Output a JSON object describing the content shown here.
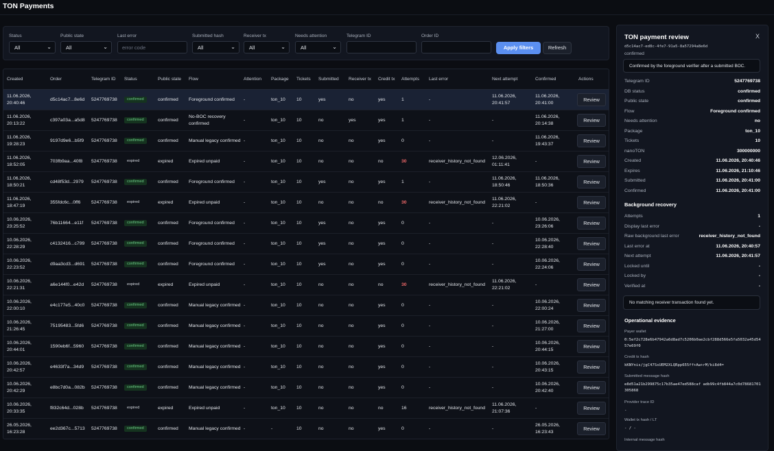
{
  "app": {
    "title": "TON Payments"
  },
  "filters": {
    "status": {
      "label": "Status",
      "value": "All"
    },
    "public_state": {
      "label": "Public state",
      "value": "All"
    },
    "last_error": {
      "label": "Last error",
      "placeholder": "error code"
    },
    "submitted_hash": {
      "label": "Submitted hash",
      "value": "All"
    },
    "receiver_tx": {
      "label": "Receiver tx",
      "value": "All"
    },
    "needs_attention": {
      "label": "Needs attention",
      "value": "All"
    },
    "telegram_id": {
      "label": "Telegram ID",
      "value": ""
    },
    "order_id": {
      "label": "Order ID",
      "value": ""
    },
    "apply_label": "Apply filters",
    "refresh_label": "Refresh"
  },
  "table": {
    "columns": [
      "Created",
      "Order",
      "Telegram ID",
      "Status",
      "Public state",
      "Flow",
      "Attention",
      "Package",
      "Tickets",
      "Submitted",
      "Receiver tx",
      "Credit tx",
      "Attempts",
      "Last error",
      "Next attempt",
      "Confirmed",
      "Actions"
    ],
    "review_label": "Review",
    "rows": [
      {
        "created": "11.06.2026, 20:40:46",
        "order": "d5c14ac7...8e6d",
        "tg": "5247769738",
        "status": "confirmed",
        "public_state": "confirmed",
        "flow": "Foreground confirmed",
        "attention": "-",
        "package": "ton_10",
        "tickets": "10",
        "submitted": "yes",
        "receiver": "no",
        "credit": "yes",
        "attempts": "1",
        "last_error": "-",
        "next_attempt": "11.06.2026, 20:41:57",
        "confirmed": "11.06.2026, 20:41:00",
        "selected": true
      },
      {
        "created": "11.06.2026, 20:13:22",
        "order": "c397a03a...a5d8",
        "tg": "5247769738",
        "status": "confirmed",
        "public_state": "confirmed",
        "flow": "No-BOC recovery confirmed",
        "attention": "-",
        "package": "ton_10",
        "tickets": "10",
        "submitted": "no",
        "receiver": "yes",
        "credit": "yes",
        "attempts": "1",
        "last_error": "-",
        "next_attempt": "-",
        "confirmed": "11.06.2026, 20:14:38"
      },
      {
        "created": "11.06.2026, 19:28:23",
        "order": "9197d9e6...b5f9",
        "tg": "5247769738",
        "status": "confirmed",
        "public_state": "confirmed",
        "flow": "Manual legacy confirmed",
        "attention": "-",
        "package": "ton_10",
        "tickets": "10",
        "submitted": "no",
        "receiver": "no",
        "credit": "yes",
        "attempts": "0",
        "last_error": "-",
        "next_attempt": "-",
        "confirmed": "11.06.2026, 19:43:37"
      },
      {
        "created": "11.06.2026, 18:52:05",
        "order": "703fb9aa...40f8",
        "tg": "5247769738",
        "status": "expired",
        "public_state": "expired",
        "flow": "Expired unpaid",
        "attention": "-",
        "package": "ton_10",
        "tickets": "10",
        "submitted": "no",
        "receiver": "no",
        "credit": "no",
        "attempts": "30",
        "last_error": "receiver_history_not_found",
        "next_attempt": "12.06.2026, 01:11:41",
        "confirmed": "-"
      },
      {
        "created": "11.06.2026, 18:50:21",
        "order": "cd48f53d...2979",
        "tg": "5247769738",
        "status": "confirmed",
        "public_state": "confirmed",
        "flow": "Foreground confirmed",
        "attention": "-",
        "package": "ton_10",
        "tickets": "10",
        "submitted": "yes",
        "receiver": "no",
        "credit": "yes",
        "attempts": "1",
        "last_error": "-",
        "next_attempt": "11.06.2026, 18:50:46",
        "confirmed": "11.06.2026, 18:50:36"
      },
      {
        "created": "11.06.2026, 18:47:19",
        "order": "355fdc6c...0ff6",
        "tg": "5247769738",
        "status": "expired",
        "public_state": "expired",
        "flow": "Expired unpaid",
        "attention": "-",
        "package": "ton_10",
        "tickets": "10",
        "submitted": "no",
        "receiver": "no",
        "credit": "no",
        "attempts": "30",
        "last_error": "receiver_history_not_found",
        "next_attempt": "11.06.2026, 22:21:02",
        "confirmed": "-"
      },
      {
        "created": "10.06.2026, 23:25:52",
        "order": "76b11664...e11f",
        "tg": "5247769738",
        "status": "confirmed",
        "public_state": "confirmed",
        "flow": "Foreground confirmed",
        "attention": "-",
        "package": "ton_10",
        "tickets": "10",
        "submitted": "yes",
        "receiver": "no",
        "credit": "yes",
        "attempts": "0",
        "last_error": "-",
        "next_attempt": "-",
        "confirmed": "10.06.2026, 23:26:06"
      },
      {
        "created": "10.06.2026, 22:28:29",
        "order": "c4132416...c799",
        "tg": "5247769738",
        "status": "confirmed",
        "public_state": "confirmed",
        "flow": "Foreground confirmed",
        "attention": "-",
        "package": "ton_10",
        "tickets": "10",
        "submitted": "yes",
        "receiver": "no",
        "credit": "yes",
        "attempts": "0",
        "last_error": "-",
        "next_attempt": "-",
        "confirmed": "10.06.2026, 22:28:40"
      },
      {
        "created": "10.06.2026, 22:23:52",
        "order": "d9aa3cd3...d691",
        "tg": "5247769738",
        "status": "confirmed",
        "public_state": "confirmed",
        "flow": "Foreground confirmed",
        "attention": "-",
        "package": "ton_10",
        "tickets": "10",
        "submitted": "yes",
        "receiver": "no",
        "credit": "yes",
        "attempts": "0",
        "last_error": "-",
        "next_attempt": "-",
        "confirmed": "10.06.2026, 22:24:06"
      },
      {
        "created": "10.06.2026, 22:21:31",
        "order": "a6e144f0...e42d",
        "tg": "5247769738",
        "status": "expired",
        "public_state": "expired",
        "flow": "Expired unpaid",
        "attention": "-",
        "package": "ton_10",
        "tickets": "10",
        "submitted": "no",
        "receiver": "no",
        "credit": "no",
        "attempts": "30",
        "last_error": "receiver_history_not_found",
        "next_attempt": "11.06.2026, 22:21:02",
        "confirmed": "-"
      },
      {
        "created": "10.06.2026, 22:00:10",
        "order": "e4c177e5...40c0",
        "tg": "5247769738",
        "status": "confirmed",
        "public_state": "confirmed",
        "flow": "Manual legacy confirmed",
        "attention": "-",
        "package": "ton_10",
        "tickets": "10",
        "submitted": "no",
        "receiver": "no",
        "credit": "yes",
        "attempts": "0",
        "last_error": "-",
        "next_attempt": "-",
        "confirmed": "10.06.2026, 22:00:24"
      },
      {
        "created": "10.06.2026, 21:26:45",
        "order": "75195483...5fd6",
        "tg": "5247769738",
        "status": "confirmed",
        "public_state": "confirmed",
        "flow": "Manual legacy confirmed",
        "attention": "-",
        "package": "ton_10",
        "tickets": "10",
        "submitted": "no",
        "receiver": "no",
        "credit": "yes",
        "attempts": "0",
        "last_error": "-",
        "next_attempt": "-",
        "confirmed": "10.06.2026, 21:27:00"
      },
      {
        "created": "10.06.2026, 20:44:01",
        "order": "1590eb6f...5960",
        "tg": "5247769738",
        "status": "confirmed",
        "public_state": "confirmed",
        "flow": "Manual legacy confirmed",
        "attention": "-",
        "package": "ton_10",
        "tickets": "10",
        "submitted": "no",
        "receiver": "no",
        "credit": "yes",
        "attempts": "0",
        "last_error": "-",
        "next_attempt": "-",
        "confirmed": "10.06.2026, 20:44:15"
      },
      {
        "created": "10.06.2026, 20:42:57",
        "order": "e4633f7a...34d9",
        "tg": "5247769738",
        "status": "confirmed",
        "public_state": "confirmed",
        "flow": "Manual legacy confirmed",
        "attention": "-",
        "package": "ton_10",
        "tickets": "10",
        "submitted": "no",
        "receiver": "no",
        "credit": "yes",
        "attempts": "0",
        "last_error": "-",
        "next_attempt": "-",
        "confirmed": "10.06.2026, 20:43:15"
      },
      {
        "created": "10.06.2026, 20:42:29",
        "order": "e8bc7d0a...082b",
        "tg": "5247769738",
        "status": "confirmed",
        "public_state": "confirmed",
        "flow": "Manual legacy confirmed",
        "attention": "-",
        "package": "ton_10",
        "tickets": "10",
        "submitted": "no",
        "receiver": "no",
        "credit": "yes",
        "attempts": "0",
        "last_error": "-",
        "next_attempt": "-",
        "confirmed": "10.06.2026, 20:42:40"
      },
      {
        "created": "10.06.2026, 20:33:35",
        "order": "f832c64d...028b",
        "tg": "5247769738",
        "status": "expired",
        "public_state": "expired",
        "flow": "Expired unpaid",
        "attention": "-",
        "package": "ton_10",
        "tickets": "10",
        "submitted": "no",
        "receiver": "no",
        "credit": "no",
        "attempts": "16",
        "last_error": "receiver_history_not_found",
        "next_attempt": "11.06.2026, 21:07:36",
        "confirmed": "-"
      },
      {
        "created": "26.05.2026, 16:23:28",
        "order": "ee2d367c...5713",
        "tg": "5247769738",
        "status": "confirmed",
        "public_state": "confirmed",
        "flow": "Manual legacy confirmed",
        "attention": "-",
        "package": "-",
        "tickets": "10",
        "submitted": "no",
        "receiver": "no",
        "credit": "yes",
        "attempts": "0",
        "last_error": "-",
        "next_attempt": "-",
        "confirmed": "26.05.2026, 16:23:43"
      }
    ]
  },
  "panel": {
    "title": "TON payment review",
    "close": "X",
    "payment_id": "d5c14ac7-ed8c-4fe7-91a5-8a57294a8e6d",
    "status_sub": "confirmed",
    "status_note": "Confirmed by the foreground verifier after a submitted BOC.",
    "details": [
      {
        "k": "Telegram ID",
        "v": "5247769738"
      },
      {
        "k": "DB status",
        "v": "confirmed"
      },
      {
        "k": "Public state",
        "v": "confirmed"
      },
      {
        "k": "Flow",
        "v": "Foreground confirmed"
      },
      {
        "k": "Needs attention",
        "v": "no"
      },
      {
        "k": "Package",
        "v": "ton_10"
      },
      {
        "k": "Tickets",
        "v": "10"
      },
      {
        "k": "nanoTON",
        "v": "300000000"
      },
      {
        "k": "Created",
        "v": "11.06.2026, 20:40:46"
      },
      {
        "k": "Expires",
        "v": "11.06.2026, 21:10:46"
      },
      {
        "k": "Submitted",
        "v": "11.06.2026, 20:41:00"
      },
      {
        "k": "Confirmed",
        "v": "11.06.2026, 20:41:00"
      }
    ],
    "bg_title": "Background recovery",
    "bg_details": [
      {
        "k": "Attempts",
        "v": "1"
      },
      {
        "k": "Display last error",
        "v": "-"
      },
      {
        "k": "Raw background last error",
        "v": "receiver_history_not_found"
      },
      {
        "k": "Last error at",
        "v": "11.06.2026, 20:40:57"
      },
      {
        "k": "Next attempt",
        "v": "11.06.2026, 20:41:57"
      },
      {
        "k": "Locked until",
        "v": "-"
      },
      {
        "k": "Locked by",
        "v": "-"
      },
      {
        "k": "Verified at",
        "v": "-"
      }
    ],
    "bg_note": "No matching receiver transaction found yet.",
    "ev_title": "Operational evidence",
    "evidence": [
      {
        "label": "Payer wallet",
        "value": "0:5ef2c728e6b47942a6d8ad7c5206b0ae2cbf288d566e5fa5032a45d5457e69f0"
      },
      {
        "label": "Credit tx hash",
        "value": "kKNYnis/jgC47SsUEM2XLQRpp655ff+Aw+rM/ki8d4="
      },
      {
        "label": "Submitted message hash",
        "value": "e8d51a21b299875c17b35ae47ed588caf adb99c4fb844a7c0d78681701305868"
      },
      {
        "label": "Provider trace ID",
        "value": "-"
      },
      {
        "label": "Wallet tx hash / LT",
        "value": "- / -"
      },
      {
        "label": "Internal message hash",
        "value": ""
      }
    ]
  }
}
